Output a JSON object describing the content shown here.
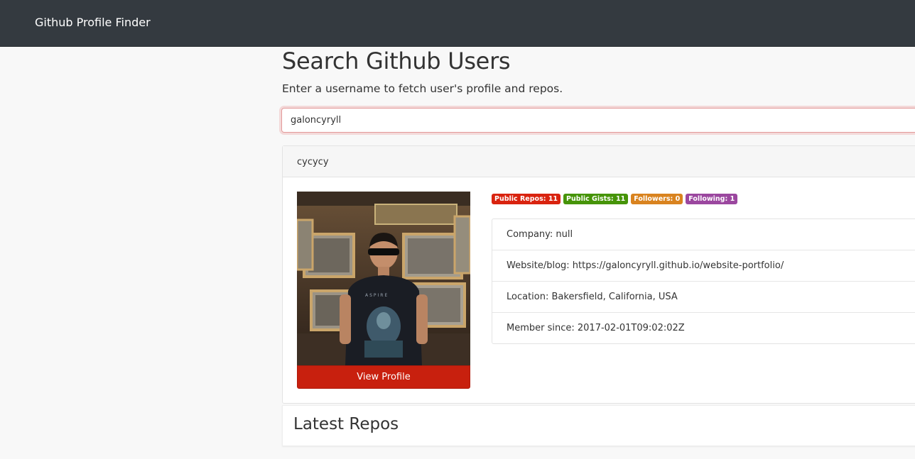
{
  "navbar": {
    "brand": "Github Profile Finder"
  },
  "search": {
    "title": "Search Github Users",
    "lead": "Enter a username to fetch user's profile and repos.",
    "value": "galoncyryll"
  },
  "profile": {
    "name": "cycycy",
    "view_profile_label": "View Profile",
    "badges": [
      {
        "label": "Public Repos: 11",
        "color": "#d9230f"
      },
      {
        "label": "Public Gists: 11",
        "color": "#469408"
      },
      {
        "label": "Followers: 0",
        "color": "#d9831f"
      },
      {
        "label": "Following: 1",
        "color": "#9b479f"
      }
    ],
    "details": [
      "Company: null",
      "Website/blog: https://galoncyryll.github.io/website-portfolio/",
      "Location: Bakersfield, California, USA",
      "Member since: 2017-02-01T09:02:02Z"
    ]
  },
  "repos": {
    "title": "Latest Repos"
  }
}
